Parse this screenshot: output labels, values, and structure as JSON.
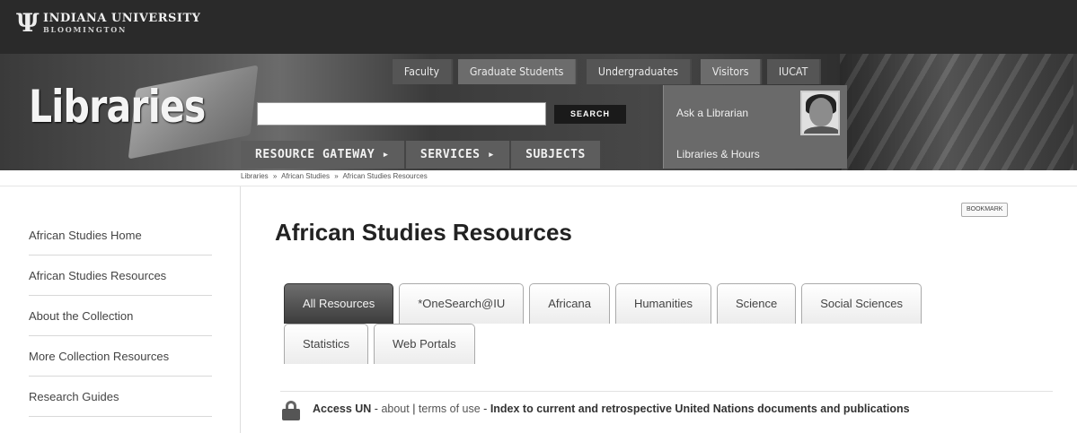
{
  "branding": {
    "university_name": "INDIANA UNIVERSITY",
    "campus": "BLOOMINGTON",
    "trident": "Ψ",
    "site_title": "Libraries"
  },
  "audience_nav": [
    "Faculty",
    "Graduate Students",
    "Undergraduates",
    "Visitors",
    "IUCAT"
  ],
  "search": {
    "button_label": "SEARCH",
    "value": ""
  },
  "ask": {
    "label": "Ask a Librarian",
    "hours_label": "Libraries & Hours"
  },
  "main_nav": [
    "RESOURCE GATEWAY ▸",
    "SERVICES ▸",
    "SUBJECTS"
  ],
  "breadcrumb": [
    "Libraries",
    "»",
    "African Studies",
    "»",
    "African Studies Resources"
  ],
  "sidebar": {
    "items": [
      "African Studies Home",
      "African Studies Resources",
      "About the Collection",
      "More Collection Resources",
      "Research Guides"
    ]
  },
  "bookmark_label": "BOOKMARK",
  "page_title": "African Studies Resources",
  "tabs": {
    "row1": [
      "All Resources",
      "*OneSearch@IU",
      "Africana",
      "Humanities",
      "Science",
      "Social Sciences"
    ],
    "row2": [
      "Statistics",
      "Web Portals"
    ],
    "active": "All Resources"
  },
  "resource": {
    "name": "Access UN",
    "sep1": " - ",
    "about": "about",
    "pipe": " | ",
    "terms": "terms of use",
    "sep2": " - ",
    "description": "Index to current and retrospective United Nations documents and publications"
  },
  "colors": {
    "topbar": "#2a2a2a",
    "active_tab": "#4a4a4a",
    "search_button": "#1a1a1a"
  }
}
